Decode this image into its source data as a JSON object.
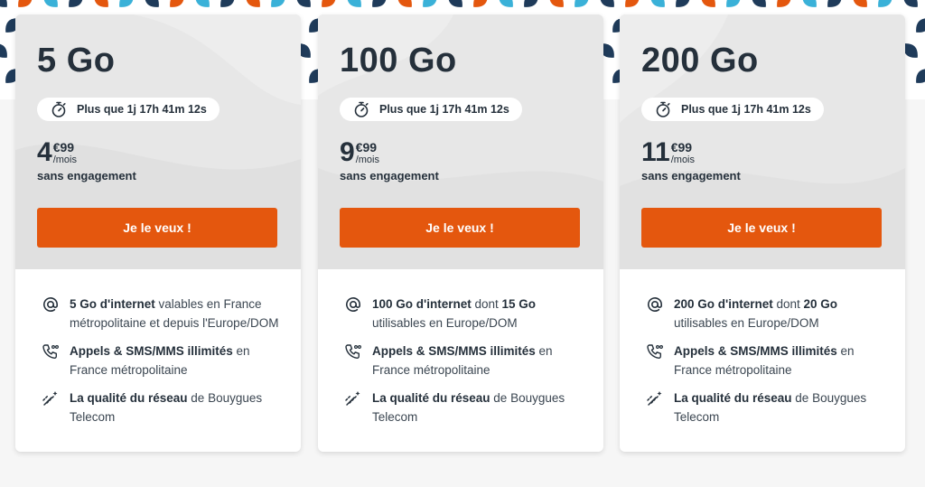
{
  "colors": {
    "accent": "#e4570e",
    "text": "#25303b",
    "card_top": "#e7e7e7",
    "pattern_navy": "#1f3b5a",
    "pattern_orange": "#e4570e",
    "pattern_cyan": "#3ab1d8"
  },
  "cta_label": "Je le veux !",
  "plans": [
    {
      "name": "5 Go",
      "timer": "Plus que 1j 17h 41m 12s",
      "price_int": "4",
      "price_dec": "€99",
      "price_unit": "/mois",
      "commitment": "sans engagement",
      "features": [
        {
          "icon": "at-icon",
          "bold": "5 Go d'internet",
          "text": " valables en France métropolitaine et depuis l'Europe/DOM",
          "bold2": "",
          "text2": ""
        },
        {
          "icon": "phone-icon",
          "bold": "Appels & SMS/MMS illimités",
          "text": " en France métropolitaine",
          "bold2": "",
          "text2": ""
        },
        {
          "icon": "network-icon",
          "bold": "La qualité du réseau",
          "text": " de Bouygues Telecom",
          "bold2": "",
          "text2": ""
        }
      ]
    },
    {
      "name": "100 Go",
      "timer": "Plus que 1j 17h 41m 12s",
      "price_int": "9",
      "price_dec": "€99",
      "price_unit": "/mois",
      "commitment": "sans engagement",
      "features": [
        {
          "icon": "at-icon",
          "bold": "100 Go d'internet",
          "text": " dont ",
          "bold2": "15 Go",
          "text2": " utilisables en Europe/DOM"
        },
        {
          "icon": "phone-icon",
          "bold": "Appels & SMS/MMS illimités",
          "text": " en France métropolitaine",
          "bold2": "",
          "text2": ""
        },
        {
          "icon": "network-icon",
          "bold": "La qualité du réseau",
          "text": " de Bouygues Telecom",
          "bold2": "",
          "text2": ""
        }
      ]
    },
    {
      "name": "200 Go",
      "timer": "Plus que 1j 17h 41m 12s",
      "price_int": "11",
      "price_dec": "€99",
      "price_unit": "/mois",
      "commitment": "sans engagement",
      "features": [
        {
          "icon": "at-icon",
          "bold": "200 Go d'internet",
          "text": " dont ",
          "bold2": "20 Go",
          "text2": " utilisables en Europe/DOM"
        },
        {
          "icon": "phone-icon",
          "bold": "Appels & SMS/MMS illimités",
          "text": " en France métropolitaine",
          "bold2": "",
          "text2": ""
        },
        {
          "icon": "network-icon",
          "bold": "La qualité du réseau",
          "text": " de Bouygues Telecom",
          "bold2": "",
          "text2": ""
        }
      ]
    }
  ]
}
